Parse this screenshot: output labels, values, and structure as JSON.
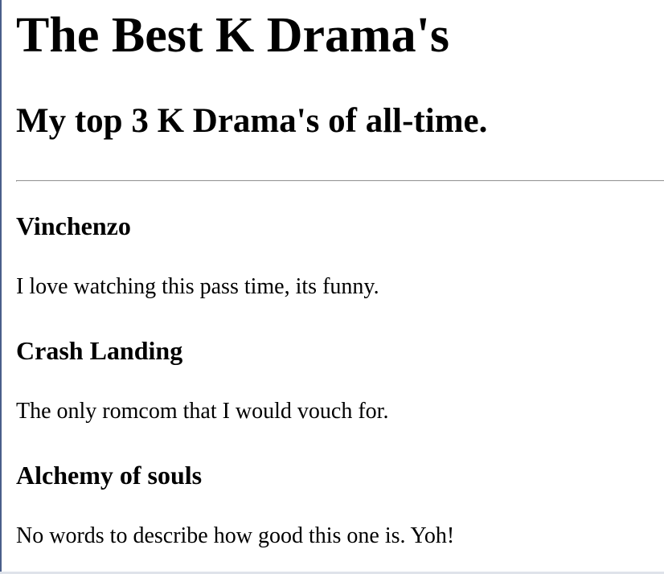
{
  "page": {
    "title": "The Best K Drama's",
    "subtitle": "My top 3 K Drama's of all-time."
  },
  "dramas": [
    {
      "title": "Vinchenzo",
      "description": "I love watching this pass time, its funny."
    },
    {
      "title": "Crash Landing",
      "description": "The only romcom that I would vouch for."
    },
    {
      "title": "Alchemy of souls",
      "description": "No words to describe how good this one is. Yoh!"
    }
  ]
}
